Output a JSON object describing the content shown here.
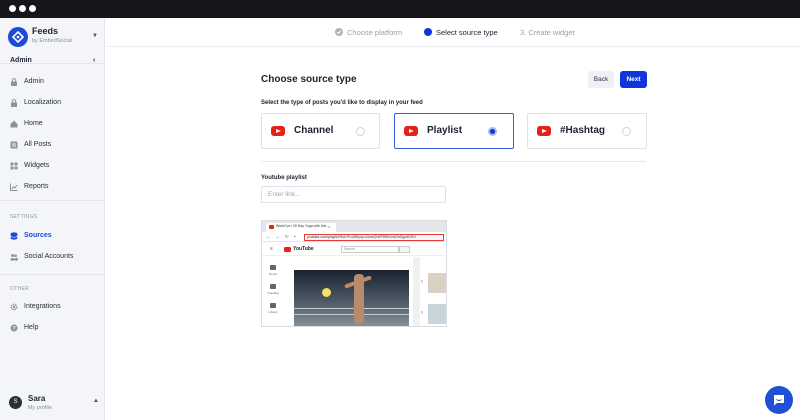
{
  "brand": {
    "name": "Feeds",
    "subtitle": "by EmbedSocial"
  },
  "sidebar": {
    "admin_heading": "Admin",
    "main_items": [
      {
        "label": "Admin",
        "icon": "lock-icon"
      },
      {
        "label": "Localization",
        "icon": "lock-icon"
      },
      {
        "label": "Home",
        "icon": "home-icon"
      },
      {
        "label": "All Posts",
        "icon": "posts-icon"
      },
      {
        "label": "Widgets",
        "icon": "widgets-icon"
      },
      {
        "label": "Reports",
        "icon": "reports-icon"
      }
    ],
    "settings_label": "SETTINGS",
    "settings_items": [
      {
        "label": "Sources",
        "icon": "database-icon",
        "active": true
      },
      {
        "label": "Social Accounts",
        "icon": "users-icon"
      }
    ],
    "other_label": "OTHER",
    "other_items": [
      {
        "label": "Integrations",
        "icon": "gear-icon"
      },
      {
        "label": "Help",
        "icon": "help-icon"
      }
    ]
  },
  "user": {
    "initial": "S",
    "name": "Sara",
    "subtitle": "My profile"
  },
  "stepper": {
    "steps": [
      {
        "label": "Choose platform",
        "state": "done"
      },
      {
        "label": "Select source type",
        "state": "active"
      },
      {
        "label": "3.  Create widget",
        "state": "pending"
      }
    ]
  },
  "page": {
    "title": "Choose source type",
    "back_label": "Back",
    "next_label": "Next",
    "subtitle": "Select the type of posts you'd like to display in your feed"
  },
  "source_types": [
    {
      "label": "Channel",
      "selected": false
    },
    {
      "label": "Playlist",
      "selected": true
    },
    {
      "label": "#Hashtag",
      "selected": false
    }
  ],
  "playlist_field": {
    "label": "Youtube playlist",
    "placeholder": "Enter link..."
  },
  "preview": {
    "tab_title": "WorkOut • 30 Day Yoga with Adr...",
    "url": "youtube.com/playlist?list=PLui6Eyny-UzwxQrWFR5bXmtGnEgo4DSH",
    "logo_text": "YouTube",
    "search_placeholder": "Search",
    "side_labels": [
      "Home",
      "Trending",
      "Library"
    ]
  },
  "colors": {
    "accent": "#1035d9",
    "sidebar_bg": "#f4f5f8",
    "youtube_red": "#e62117"
  }
}
